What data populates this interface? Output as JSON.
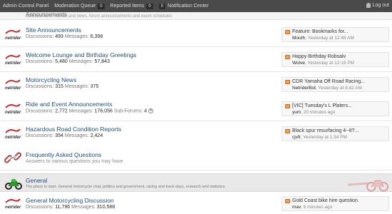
{
  "adminbar": {
    "items": [
      {
        "label": "Admin Control Panel"
      },
      {
        "label": "Moderation Queue",
        "count": "0"
      },
      {
        "label": "Reported Items",
        "count": "0"
      },
      {
        "label": "Notification Center",
        "count": "0"
      }
    ],
    "logout": "Log out"
  },
  "top_faded": {
    "title": "Announcements",
    "text": "Administrative notices and news, forum announcements and event schedules"
  },
  "labels": {
    "discussions": "Discussions:",
    "messages": "Messages:",
    "subforums": "Sub-Forums:"
  },
  "forums": [
    {
      "title": "Site Announcements",
      "discussions": "493",
      "messages": "6,398",
      "last_title": "Feature: Bookmarks for...",
      "last_user": "Mouth",
      "last_time": "Yesterday at 12:48 AM"
    },
    {
      "title": "Welcome Lounge and Birthday Greetings",
      "discussions": "5,480",
      "messages": "57,843",
      "last_title": "Happy Birthday Robsalv",
      "last_user": "Wolve",
      "last_time": "Yesterday at 12:19 PM"
    },
    {
      "title": "Motorcycling News",
      "discussions": "315",
      "messages": "375",
      "last_title": "CDR Yamaha Off Road Racing...",
      "last_user": "NetriderBot",
      "last_time": "Yesterday at 8:42 AM"
    },
    {
      "title": "Ride and Event Announcements",
      "discussions": "2,772",
      "messages": "176,056",
      "subforums": "4",
      "last_title": "[VIC] Tuesday's L Platers...",
      "last_user": "yum",
      "last_time": "20 minutes ago"
    },
    {
      "title": "Hazardous Road Condition Reports",
      "discussions": "354",
      "messages": "2,424",
      "last_title": "Black spur resurfacing 4--8?...",
      "last_user": "cjvfr",
      "last_time": "Yesterday at 1:34 PM"
    }
  ],
  "faq": {
    "title": "Frequently Asked Questions",
    "desc": "Answers to various questions you may have"
  },
  "category": {
    "title": "General",
    "desc": "The place to start. General motorcycle chat, politics and government, racing and track days, research and statistics."
  },
  "general_forum": {
    "title": "General Motorcycling Discussion",
    "discussions": "11,796",
    "messages": "310,588",
    "last_title": "Gold Coast bike hire question.",
    "last_user": "mav",
    "last_time": "9 minutes ago"
  },
  "icons": {
    "forum": "netrider-logo-icon",
    "faq": "link-icon",
    "category": "green-motorcycle-icon",
    "lastpost": "thread-icon"
  }
}
